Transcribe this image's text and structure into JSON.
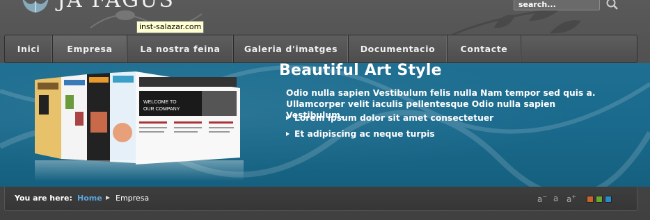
{
  "header": {
    "logo_text": "JA FAGUS",
    "search_placeholder": "search...",
    "tooltip": "inst-salazar.com"
  },
  "nav": {
    "items": [
      {
        "label": "Inici",
        "active": false
      },
      {
        "label": "Empresa",
        "active": true
      },
      {
        "label": "La nostra feina",
        "active": false
      },
      {
        "label": "Galeria d'imatges",
        "active": false
      },
      {
        "label": "Documentacio",
        "active": false
      },
      {
        "label": "Contacte",
        "active": false
      }
    ]
  },
  "hero": {
    "title": "Beautiful Art Style",
    "body": "Odio nulla sapien Vestibulum felis nulla Nam tempor sed quis a. Ullamcorper velit iaculis pellentesque Odio nulla sapien Vestibulum.",
    "bullets": [
      "Lorem ipsum dolor sit amet consectetuer",
      "Et adipiscing ac neque turpis"
    ]
  },
  "breadcrumb": {
    "label": "You are here:",
    "home": "Home",
    "current": "Empresa"
  },
  "font_size": {
    "decrease": "a",
    "decrease_sup": "−",
    "reset": "a",
    "increase": "a",
    "increase_sup": "+"
  },
  "colors": {
    "accent_blue": "#1a6a8d",
    "link_blue": "#5aa5da",
    "swatch_orange": "#c8642a",
    "swatch_green": "#6aa832",
    "swatch_blue": "#2a8ac8"
  }
}
